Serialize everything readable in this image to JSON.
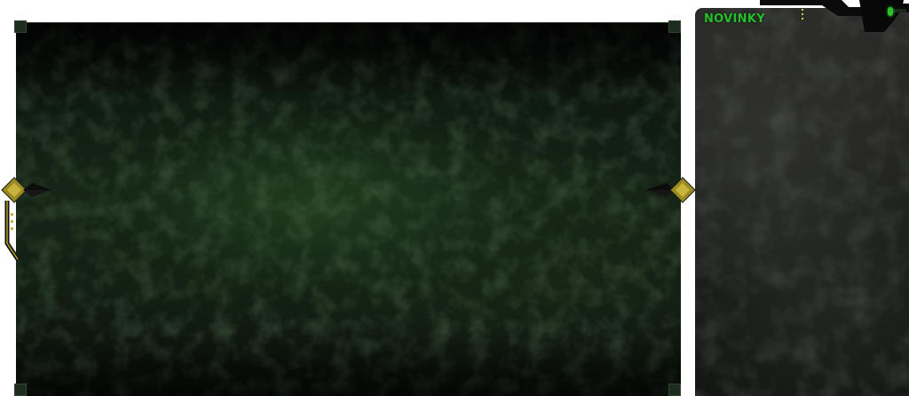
{
  "sidebar": {
    "title": "NOVINKY"
  },
  "banner": {
    "prev_icon": "chevron-left-icon",
    "next_icon": "chevron-right-icon"
  },
  "colors": {
    "accent_green": "#23c02a",
    "arrow_gold": "#b5a22c",
    "panel_dark": "#0d170e",
    "sidebar_dark": "#262725"
  }
}
